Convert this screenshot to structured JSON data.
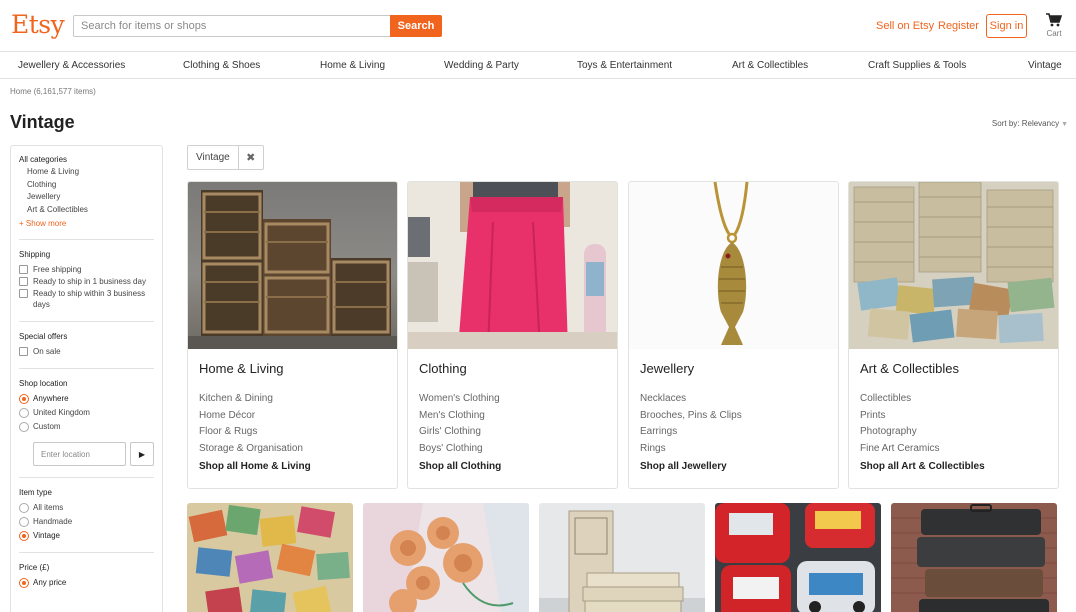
{
  "header": {
    "logo": "Etsy",
    "search_placeholder": "Search for items or shops",
    "search_button": "Search",
    "sell": "Sell on Etsy",
    "register": "Register",
    "signin": "Sign in",
    "cart": "Cart",
    "accent": "#f1641e"
  },
  "nav": {
    "items": [
      "Jewellery & Accessories",
      "Clothing & Shoes",
      "Home & Living",
      "Wedding & Party",
      "Toys & Entertainment",
      "Art & Collectibles",
      "Craft Supplies & Tools",
      "Vintage"
    ]
  },
  "breadcrumb": "Home (6,161,577 items)",
  "page_title": "Vintage",
  "sort": {
    "label": "Sort by: Relevancy"
  },
  "sidebar": {
    "categories_head": "All categories",
    "categories": [
      "Home & Living",
      "Clothing",
      "Jewellery",
      "Art & Collectibles"
    ],
    "show_more": "+ Show more",
    "shipping_head": "Shipping",
    "shipping": [
      "Free shipping",
      "Ready to ship in 1 business day",
      "Ready to ship within 3 business days"
    ],
    "offers_head": "Special offers",
    "offers": [
      "On sale"
    ],
    "location_head": "Shop location",
    "locations": [
      "Anywhere",
      "United Kingdom",
      "Custom"
    ],
    "location_selected": "Anywhere",
    "location_placeholder": "Enter location",
    "itemtype_head": "Item type",
    "itemtypes": [
      "All items",
      "Handmade",
      "Vintage"
    ],
    "itemtype_selected": "Vintage",
    "price_head": "Price (£)",
    "price_selected": "Any price"
  },
  "filter_tag": {
    "label": "Vintage"
  },
  "cards": [
    {
      "title": "Home & Living",
      "links": [
        "Kitchen & Dining",
        "Home Décor",
        "Floor & Rugs",
        "Storage & Organisation"
      ],
      "shop_all": "Shop all Home & Living"
    },
    {
      "title": "Clothing",
      "links": [
        "Women's Clothing",
        "Men's Clothing",
        "Girls' Clothing",
        "Boys' Clothing"
      ],
      "shop_all": "Shop all Clothing"
    },
    {
      "title": "Jewellery",
      "links": [
        "Necklaces",
        "Brooches, Pins & Clips",
        "Earrings",
        "Rings"
      ],
      "shop_all": "Shop all Jewellery"
    },
    {
      "title": "Art & Collectibles",
      "links": [
        "Collectibles",
        "Prints",
        "Photography",
        "Fine Art Ceramics"
      ],
      "shop_all": "Shop all Art & Collectibles"
    }
  ]
}
